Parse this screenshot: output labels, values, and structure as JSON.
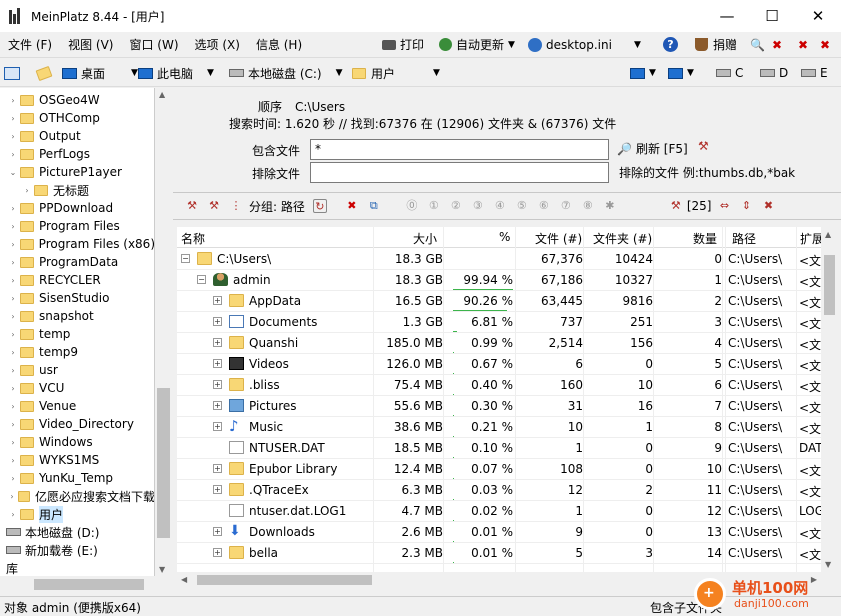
{
  "window": {
    "title": "MeinPlatz 8.44 - [用户]",
    "minimize": "—",
    "maximize": "☐",
    "close": "✕"
  },
  "menu": [
    "文件 (F)",
    "视图 (V)",
    "窗口 (W)",
    "选项 (X)",
    "信息 (H)"
  ],
  "menu_right": {
    "print": "打印",
    "autoupdate": "自动更新",
    "ini": "desktop.ini",
    "help": "?",
    "donate": "捐赠"
  },
  "address": {
    "desktop": "桌面",
    "pc": "此电脑",
    "disk": "本地磁盘 (C:)",
    "folder": "用户",
    "drives": [
      "C",
      "D",
      "E"
    ]
  },
  "tree": {
    "items": [
      {
        "label": "OSGeo4W",
        "type": "folder",
        "indent": 0,
        "exp": "›"
      },
      {
        "label": "OTHComp",
        "type": "folder",
        "indent": 0,
        "exp": "›"
      },
      {
        "label": "Output",
        "type": "folder",
        "indent": 0,
        "exp": "›"
      },
      {
        "label": "PerfLogs",
        "type": "folder",
        "indent": 0,
        "exp": "›"
      },
      {
        "label": "PictureP1ayer",
        "type": "folder",
        "indent": 0,
        "exp": "⌄"
      },
      {
        "label": "无标题",
        "type": "folder",
        "indent": 1,
        "exp": "›"
      },
      {
        "label": "PPDownload",
        "type": "folder",
        "indent": 0,
        "exp": "›"
      },
      {
        "label": "Program Files",
        "type": "folder",
        "indent": 0,
        "exp": "›"
      },
      {
        "label": "Program Files (x86)",
        "type": "folder",
        "indent": 0,
        "exp": "›"
      },
      {
        "label": "ProgramData",
        "type": "folder",
        "indent": 0,
        "exp": "›"
      },
      {
        "label": "RECYCLER",
        "type": "folder",
        "indent": 0,
        "exp": "›"
      },
      {
        "label": "SisenStudio",
        "type": "folder",
        "indent": 0,
        "exp": "›"
      },
      {
        "label": "snapshot",
        "type": "folder",
        "indent": 0,
        "exp": "›"
      },
      {
        "label": "temp",
        "type": "folder",
        "indent": 0,
        "exp": "›"
      },
      {
        "label": "temp9",
        "type": "folder",
        "indent": 0,
        "exp": "›"
      },
      {
        "label": "usr",
        "type": "folder",
        "indent": 0,
        "exp": "›"
      },
      {
        "label": "VCU",
        "type": "folder",
        "indent": 0,
        "exp": "›"
      },
      {
        "label": "Venue",
        "type": "folder",
        "indent": 0,
        "exp": "›"
      },
      {
        "label": "Video_Directory",
        "type": "folder",
        "indent": 0,
        "exp": "›"
      },
      {
        "label": "Windows",
        "type": "folder",
        "indent": 0,
        "exp": "›"
      },
      {
        "label": "WYKS1MS",
        "type": "folder",
        "indent": 0,
        "exp": "›"
      },
      {
        "label": "YunKu_Temp",
        "type": "folder",
        "indent": 0,
        "exp": "›"
      },
      {
        "label": "亿愿必应搜索文档下载",
        "type": "folder",
        "indent": 0,
        "exp": "›"
      },
      {
        "label": "用户",
        "type": "folder",
        "indent": 0,
        "exp": "›",
        "selected": true
      },
      {
        "label": "本地磁盘 (D:)",
        "type": "drive",
        "indent": -1,
        "exp": ""
      },
      {
        "label": "新加载卷 (E:)",
        "type": "drive",
        "indent": -1,
        "exp": ""
      },
      {
        "label": "库",
        "type": "none",
        "indent": -1,
        "exp": ""
      }
    ]
  },
  "search": {
    "order_label": "顺序",
    "order_value": "C:\\Users",
    "stats": "搜索时间: 1.620 秒 // 找到:67376 在 (12906) 文件夹 & (67376) 文件",
    "include_label": "包含文件",
    "include_value": "*",
    "exclude_label": "排除文件",
    "exclude_value": "",
    "refresh": "刷新 [F5]",
    "excluded_note": "排除的文件 例:thumbs.db,*bak"
  },
  "toolbar2": {
    "group": "分组: 路径",
    "count": "[25]"
  },
  "columns": {
    "name": "名称",
    "size": "大小",
    "pct": "%",
    "files": "文件 (#)",
    "folders": "文件夹 (#)",
    "count": "数量",
    "path": "路径",
    "ext": "扩展"
  },
  "rows": [
    {
      "name": "C:\\Users\\",
      "size": "18.3 GB",
      "pct": "",
      "pctv": 0,
      "files": "67,376",
      "folders": "10424",
      "count": "0",
      "path": "C:\\Users\\",
      "ext": "<文",
      "level": 0,
      "icon": "folder",
      "plus": "-"
    },
    {
      "name": "admin",
      "size": "18.3 GB",
      "pct": "99.94 %",
      "pctv": 99.94,
      "files": "67,186",
      "folders": "10327",
      "count": "1",
      "path": "C:\\Users\\",
      "ext": "<文",
      "level": 1,
      "icon": "user",
      "plus": "-"
    },
    {
      "name": "AppData",
      "size": "16.5 GB",
      "pct": "90.26 %",
      "pctv": 90.26,
      "files": "63,445",
      "folders": "9816",
      "count": "2",
      "path": "C:\\Users\\",
      "ext": "<文",
      "level": 2,
      "icon": "folder",
      "plus": "+"
    },
    {
      "name": "Documents",
      "size": "1.3 GB",
      "pct": "6.81 %",
      "pctv": 6.81,
      "files": "737",
      "folders": "251",
      "count": "3",
      "path": "C:\\Users\\",
      "ext": "<文",
      "level": 2,
      "icon": "doc",
      "plus": "+"
    },
    {
      "name": "Quanshi",
      "size": "185.0 MB",
      "pct": "0.99 %",
      "pctv": 0.99,
      "files": "2,514",
      "folders": "156",
      "count": "4",
      "path": "C:\\Users\\",
      "ext": "<文",
      "level": 2,
      "icon": "folder",
      "plus": "+"
    },
    {
      "name": "Videos",
      "size": "126.0 MB",
      "pct": "0.67 %",
      "pctv": 0.67,
      "files": "6",
      "folders": "0",
      "count": "5",
      "path": "C:\\Users\\",
      "ext": "<文",
      "level": 2,
      "icon": "video",
      "plus": "+"
    },
    {
      "name": ".bliss",
      "size": "75.4 MB",
      "pct": "0.40 %",
      "pctv": 0.4,
      "files": "160",
      "folders": "10",
      "count": "6",
      "path": "C:\\Users\\",
      "ext": "<文",
      "level": 2,
      "icon": "folder",
      "plus": "+"
    },
    {
      "name": "Pictures",
      "size": "55.6 MB",
      "pct": "0.30 %",
      "pctv": 0.3,
      "files": "31",
      "folders": "16",
      "count": "7",
      "path": "C:\\Users\\",
      "ext": "<文",
      "level": 2,
      "icon": "pic",
      "plus": "+"
    },
    {
      "name": "Music",
      "size": "38.6 MB",
      "pct": "0.21 %",
      "pctv": 0.21,
      "files": "10",
      "folders": "1",
      "count": "8",
      "path": "C:\\Users\\",
      "ext": "<文",
      "level": 2,
      "icon": "music",
      "plus": "+"
    },
    {
      "name": "NTUSER.DAT",
      "size": "18.5 MB",
      "pct": "0.10 %",
      "pctv": 0.1,
      "files": "1",
      "folders": "0",
      "count": "9",
      "path": "C:\\Users\\",
      "ext": "DAT",
      "level": 2,
      "icon": "file",
      "plus": ""
    },
    {
      "name": "Epubor Library",
      "size": "12.4 MB",
      "pct": "0.07 %",
      "pctv": 0.07,
      "files": "108",
      "folders": "0",
      "count": "10",
      "path": "C:\\Users\\",
      "ext": "<文",
      "level": 2,
      "icon": "folder",
      "plus": "+"
    },
    {
      "name": ".QTraceEx",
      "size": "6.3 MB",
      "pct": "0.03 %",
      "pctv": 0.03,
      "files": "12",
      "folders": "2",
      "count": "11",
      "path": "C:\\Users\\",
      "ext": "<文",
      "level": 2,
      "icon": "folder",
      "plus": "+"
    },
    {
      "name": "ntuser.dat.LOG1",
      "size": "4.7 MB",
      "pct": "0.02 %",
      "pctv": 0.02,
      "files": "1",
      "folders": "0",
      "count": "12",
      "path": "C:\\Users\\",
      "ext": "LOG",
      "level": 2,
      "icon": "file",
      "plus": ""
    },
    {
      "name": "Downloads",
      "size": "2.6 MB",
      "pct": "0.01 %",
      "pctv": 0.01,
      "files": "9",
      "folders": "0",
      "count": "13",
      "path": "C:\\Users\\",
      "ext": "<文",
      "level": 2,
      "icon": "down",
      "plus": "+"
    },
    {
      "name": "bella",
      "size": "2.3 MB",
      "pct": "0.01 %",
      "pctv": 0.01,
      "files": "5",
      "folders": "3",
      "count": "14",
      "path": "C:\\Users\\",
      "ext": "<文",
      "level": 2,
      "icon": "folder",
      "plus": "+"
    }
  ],
  "status": {
    "left": "对象 admin (便携版x64)",
    "right": "包含子文件夹"
  },
  "watermark": {
    "text": "单机100网",
    "url": "danji100.com"
  }
}
